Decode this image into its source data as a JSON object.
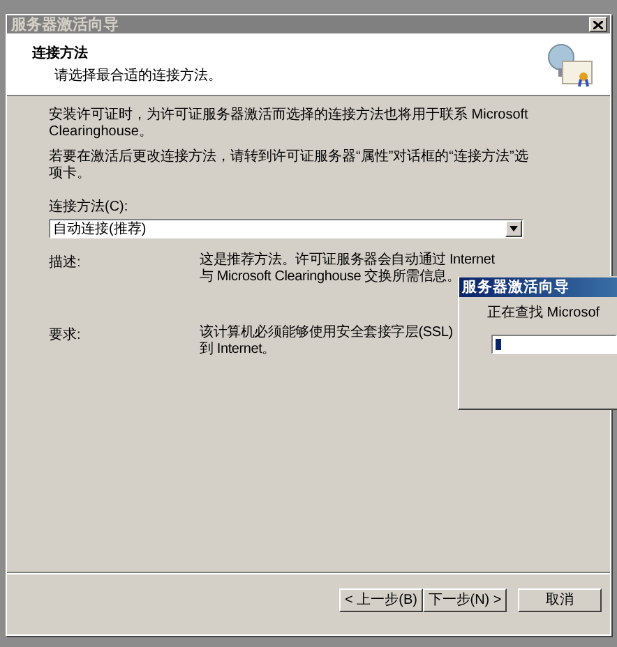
{
  "window": {
    "title": "服务器激活向导"
  },
  "header": {
    "title": "连接方法",
    "subtitle": "请选择最合适的连接方法。"
  },
  "paragraphs": [
    "安装许可证时，为许可证服务器激活而选择的连接方法也将用于联系 Microsoft Clearinghouse。",
    "若要在激活后更改连接方法，请转到许可证服务器“属性”对话框的“连接方法”选项卡。"
  ],
  "connection_field": {
    "label": "连接方法(C):",
    "value": "自动连接(推荐)"
  },
  "details": [
    {
      "label": "描述:",
      "text": "这是推荐方法。许可证服务器会自动通过 Internet\n与 Microsoft Clearinghouse 交换所需信息。"
    },
    {
      "label": "要求:",
      "text": "该计算机必须能够使用安全套接字层(SSL)\n到 Internet。"
    }
  ],
  "buttons": [
    {
      "label": "< 上一步(B)",
      "kind": "back"
    },
    {
      "label": "下一步(N) >",
      "kind": "next"
    },
    {
      "label": "取消",
      "kind": "cancel"
    }
  ],
  "progress_window": {
    "title": "服务器激活向导",
    "message": "正在查找 Microsof",
    "level": 0.05
  }
}
